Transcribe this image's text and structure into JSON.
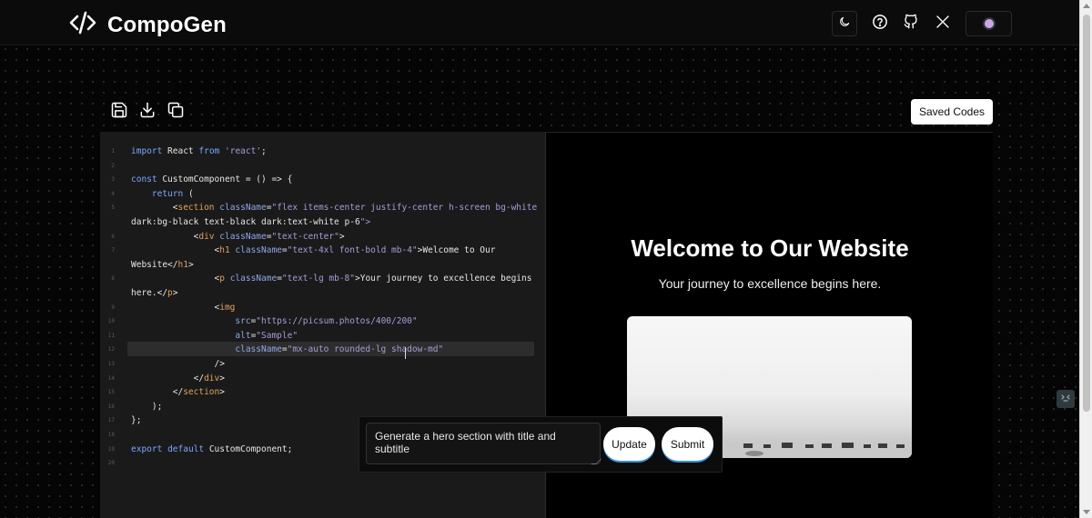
{
  "app": {
    "name": "CompoGen"
  },
  "header": {
    "icons": [
      "moon-icon",
      "help-circle-icon",
      "github-icon",
      "x-logo-icon",
      "avatar"
    ]
  },
  "toolbar": {
    "icons": [
      "save-icon",
      "download-icon",
      "copy-icon"
    ],
    "saved_codes_label": "Saved Codes"
  },
  "editor": {
    "language": "jsx",
    "lines": [
      {
        "num": "1",
        "text": "import React from 'react';"
      },
      {
        "num": "2",
        "text": ""
      },
      {
        "num": "3",
        "text": "const CustomComponent = () => {"
      },
      {
        "num": "4",
        "text": "    return ("
      },
      {
        "num": "5",
        "text": "        <section className=\"flex items-center justify-center h-screen bg-white"
      },
      {
        "num": "",
        "text": "dark:bg-black text-black dark:text-white p-6\">"
      },
      {
        "num": "6",
        "text": "            <div className=\"text-center\">"
      },
      {
        "num": "7",
        "text": "                <h1 className=\"text-4xl font-bold mb-4\">Welcome to Our"
      },
      {
        "num": "",
        "text": "Website</h1>"
      },
      {
        "num": "8",
        "text": "                <p className=\"text-lg mb-8\">Your journey to excellence begins"
      },
      {
        "num": "",
        "text": "here.</p>"
      },
      {
        "num": "9",
        "text": "                <img"
      },
      {
        "num": "10",
        "text": "                    src=\"https://picsum.photos/400/200\""
      },
      {
        "num": "11",
        "text": "                    alt=\"Sample\""
      },
      {
        "num": "12",
        "text": "                    className=\"mx-auto rounded-lg shadow-md\""
      },
      {
        "num": "13",
        "text": "                />"
      },
      {
        "num": "14",
        "text": "            </div>"
      },
      {
        "num": "15",
        "text": "        </section>"
      },
      {
        "num": "16",
        "text": "    );"
      },
      {
        "num": "17",
        "text": "};"
      },
      {
        "num": "18",
        "text": ""
      },
      {
        "num": "19",
        "text": "export default CustomComponent;"
      },
      {
        "num": "20",
        "text": ""
      }
    ],
    "active_line_index": 14
  },
  "preview": {
    "title": "Welcome to Our Website",
    "subtitle": "Your journey to excellence begins here."
  },
  "prompt": {
    "value": "Generate a hero section with title and subtitle",
    "update_label": "Update",
    "submit_label": "Submit"
  },
  "colors": {
    "background": "#050505",
    "editor_bg": "#1a1a1a",
    "keyword": "#7aa6ff",
    "string": "#a99bd8",
    "tag": "#e0a25c",
    "button_bg": "#ffffff",
    "button_shadow": "#3a8fd6"
  }
}
